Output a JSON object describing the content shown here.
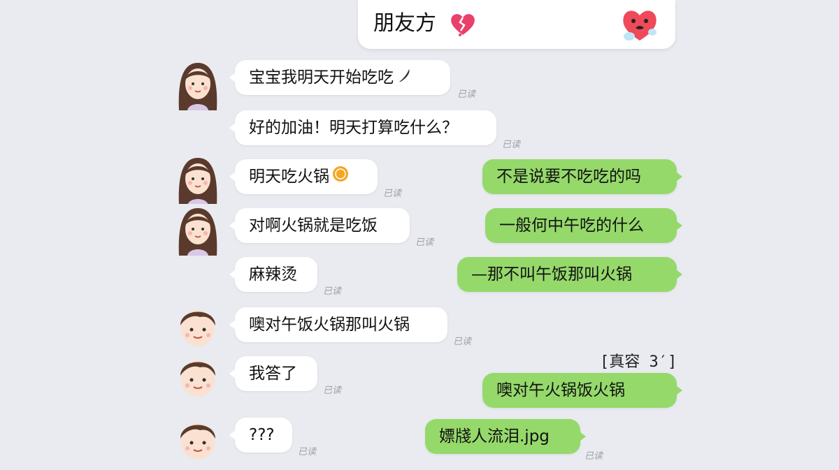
{
  "header": {
    "title": "朋友方",
    "heart_icon": "broken-heart-icon",
    "mascot_icon": "crying-heart-mascot-icon"
  },
  "colors": {
    "background": "#e9ebf0",
    "left_bubble": "#ffffff",
    "right_bubble": "#95d96b",
    "status_text": "#9aa0a8"
  },
  "messages": [
    {
      "side": "left",
      "sender": "girl",
      "text": "宝宝我明天开始吃吃",
      "icon": "pepper-icon",
      "status": "已读"
    },
    {
      "side": "left",
      "sender": "girl",
      "text": "好的加油！明天打算吃什么？",
      "status": "已读"
    },
    {
      "side": "left",
      "sender": "girl",
      "text": "明天吃火锅",
      "icon": "coin-emoji-icon",
      "status": "已读"
    },
    {
      "side": "right",
      "text": "不是说要不吃吃的吗"
    },
    {
      "side": "left",
      "sender": "girl",
      "text": "对啊火锅就是吃饭",
      "status": "已读"
    },
    {
      "side": "right",
      "text": "一般何中午吃的什么"
    },
    {
      "side": "left",
      "sender": "none",
      "text": "麻辣烫",
      "status": "已读"
    },
    {
      "side": "right",
      "text": "—那不叫午饭那叫火锅"
    },
    {
      "side": "left",
      "sender": "boy",
      "text": "噢对午饭火锅那叫火锅",
      "status": "已读"
    },
    {
      "side": "left",
      "sender": "boy",
      "text": "我答了",
      "status": "已读"
    },
    {
      "side": "right",
      "text": "噢对午火锅饭火锅"
    },
    {
      "side": "left",
      "sender": "boy",
      "text": "???",
      "status": "已读"
    },
    {
      "side": "right",
      "text": "嫖牋人流泪.jpg",
      "status": "已读"
    }
  ],
  "time_label": "[真容 3′]"
}
